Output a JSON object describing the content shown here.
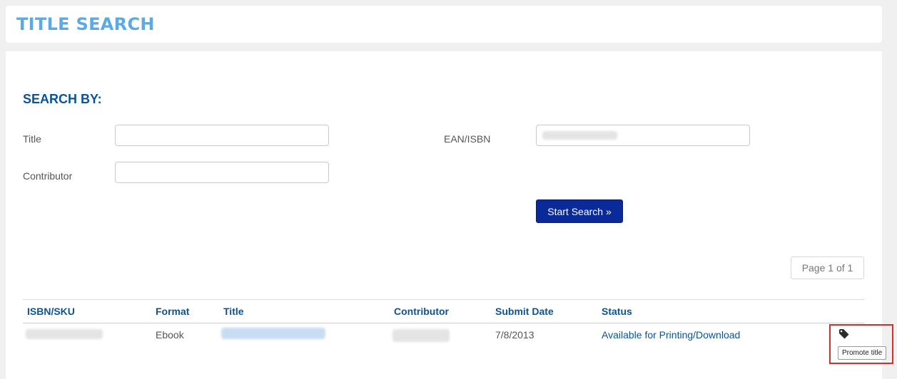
{
  "header": {
    "title": "TITLE SEARCH"
  },
  "search": {
    "section_title": "SEARCH BY:",
    "title_label": "Title",
    "title_value": "",
    "contributor_label": "Contributor",
    "contributor_value": "",
    "ean_label": "EAN/ISBN",
    "button_label": "Start Search »"
  },
  "pager": {
    "label": "Page 1 of 1"
  },
  "table": {
    "headers": [
      "ISBN/SKU",
      "Format",
      "Title",
      "Contributor",
      "Submit Date",
      "Status"
    ],
    "rows": [
      {
        "format": "Ebook",
        "submit_date": "7/8/2013",
        "status": "Available for Printing/Download"
      }
    ]
  },
  "tooltip": {
    "text": "Promote title"
  },
  "icons": {
    "promote": "tag-icon"
  },
  "colors": {
    "title": "#5aaae6",
    "accent": "#0b5394",
    "button": "#0a2a99",
    "highlight": "#d32f2f"
  }
}
